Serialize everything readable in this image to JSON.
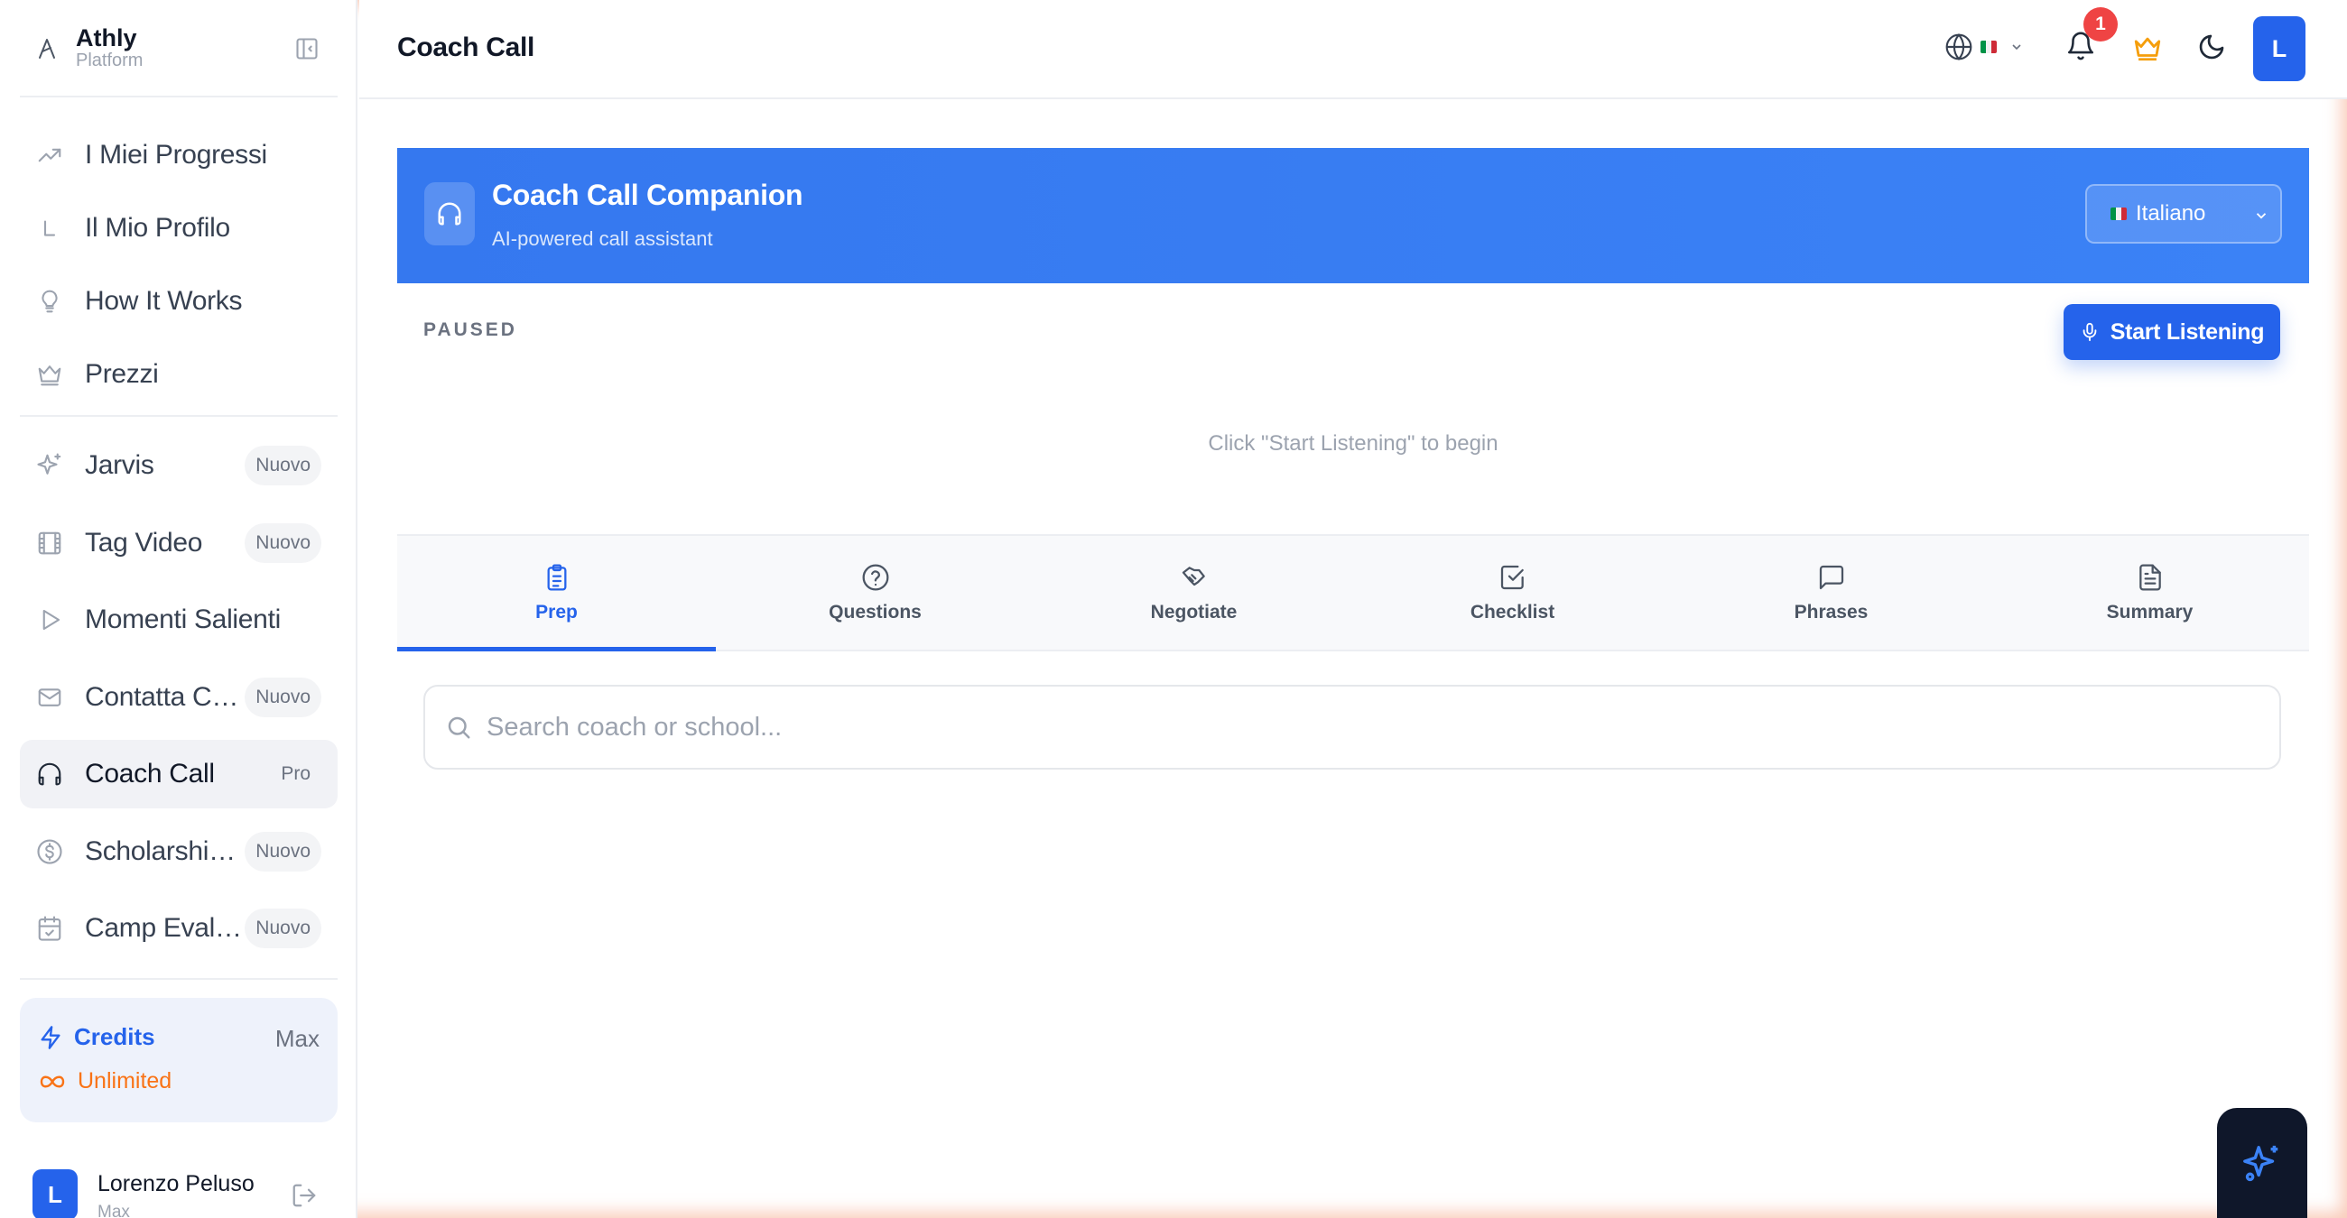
{
  "brand": {
    "name": "Athly",
    "subtitle": "Platform"
  },
  "sidebar": {
    "groups": [
      [
        {
          "id": "progress",
          "label": "I Miei Progressi",
          "icon": "trending-up-icon",
          "badge": ""
        },
        {
          "id": "profile",
          "label": "Il Mio Profilo",
          "icon": "corner-icon",
          "badge": ""
        },
        {
          "id": "how",
          "label": "How It Works",
          "icon": "lightbulb-icon",
          "badge": ""
        },
        {
          "id": "pricing",
          "label": "Prezzi",
          "icon": "crown-icon",
          "badge": ""
        }
      ],
      [
        {
          "id": "jarvis",
          "label": "Jarvis",
          "icon": "sparkles-icon",
          "badge": "Nuovo"
        },
        {
          "id": "tag-video",
          "label": "Tag Video",
          "icon": "film-icon",
          "badge": "Nuovo"
        },
        {
          "id": "highlights",
          "label": "Momenti Salienti",
          "icon": "play-icon",
          "badge": ""
        },
        {
          "id": "contact-coach",
          "label": "Contatta Coach",
          "icon": "mail-icon",
          "badge": "Nuovo"
        },
        {
          "id": "coach-call",
          "label": "Coach Call",
          "icon": "headphones-icon",
          "badge": "Pro",
          "active": true
        },
        {
          "id": "scholarship",
          "label": "Scholarship ...",
          "icon": "dollar-circle-icon",
          "badge": "Nuovo"
        },
        {
          "id": "camp",
          "label": "Camp Evalua...",
          "icon": "calendar-check-icon",
          "badge": "Nuovo"
        }
      ]
    ],
    "credits": {
      "label": "Credits",
      "plan": "Max",
      "value": "Unlimited"
    },
    "user": {
      "initial": "L",
      "name": "Lorenzo Peluso",
      "plan": "Max"
    }
  },
  "header": {
    "title": "Coach Call",
    "notifications_count": "1",
    "avatar_initial": "L"
  },
  "companion": {
    "title": "Coach Call Companion",
    "subtitle": "AI-powered call assistant",
    "language": "Italiano",
    "status": "PAUSED",
    "start_label": "Start Listening",
    "empty_hint": "Click \"Start Listening\" to begin"
  },
  "tabs": [
    {
      "id": "prep",
      "label": "Prep",
      "icon": "clipboard-list-icon",
      "active": true
    },
    {
      "id": "questions",
      "label": "Questions",
      "icon": "help-circle-icon"
    },
    {
      "id": "negotiate",
      "label": "Negotiate",
      "icon": "handshake-icon"
    },
    {
      "id": "checklist",
      "label": "Checklist",
      "icon": "check-square-icon"
    },
    {
      "id": "phrases",
      "label": "Phrases",
      "icon": "message-square-icon"
    },
    {
      "id": "summary",
      "label": "Summary",
      "icon": "file-text-icon"
    }
  ],
  "search": {
    "placeholder": "Search coach or school...",
    "value": ""
  },
  "colors": {
    "accent": "#2563eb",
    "banner": "#3b7cf0",
    "warning": "#f97316",
    "badge_red": "#ef4444"
  }
}
